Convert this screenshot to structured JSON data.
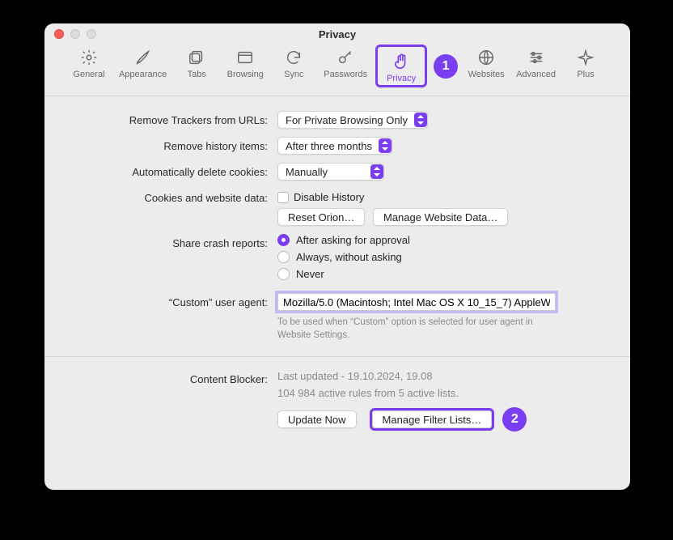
{
  "window": {
    "title": "Privacy"
  },
  "annotations": {
    "step1": "1",
    "step2": "2"
  },
  "toolbar": {
    "items": [
      {
        "label": "General"
      },
      {
        "label": "Appearance"
      },
      {
        "label": "Tabs"
      },
      {
        "label": "Browsing"
      },
      {
        "label": "Sync"
      },
      {
        "label": "Passwords"
      },
      {
        "label": "Privacy"
      },
      {
        "label": "Websites"
      },
      {
        "label": "Advanced"
      },
      {
        "label": "Plus"
      }
    ]
  },
  "settings": {
    "remove_trackers": {
      "label": "Remove Trackers from URLs:",
      "value": "For Private Browsing Only"
    },
    "remove_history": {
      "label": "Remove history items:",
      "value": "After three months"
    },
    "auto_cookies": {
      "label": "Automatically delete cookies:",
      "value": "Manually"
    },
    "cookies_data": {
      "label": "Cookies and website data:",
      "disable_history": "Disable History",
      "reset_button": "Reset Orion…",
      "manage_button": "Manage Website Data…"
    },
    "crash": {
      "label": "Share crash reports:",
      "options": [
        "After asking for approval",
        "Always, without asking",
        "Never"
      ],
      "selected": 0
    },
    "user_agent": {
      "label": "“Custom” user agent:",
      "value": "Mozilla/5.0 (Macintosh; Intel Mac OS X 10_15_7) AppleWe",
      "hint": "To be used when “Custom” option is selected for user agent in Website Settings."
    },
    "content_blocker": {
      "label": "Content Blocker:",
      "status1": "Last updated - 19.10.2024, 19.08",
      "status2": "104 984 active rules from 5 active lists.",
      "update_button": "Update Now",
      "manage_button": "Manage Filter Lists…"
    }
  }
}
